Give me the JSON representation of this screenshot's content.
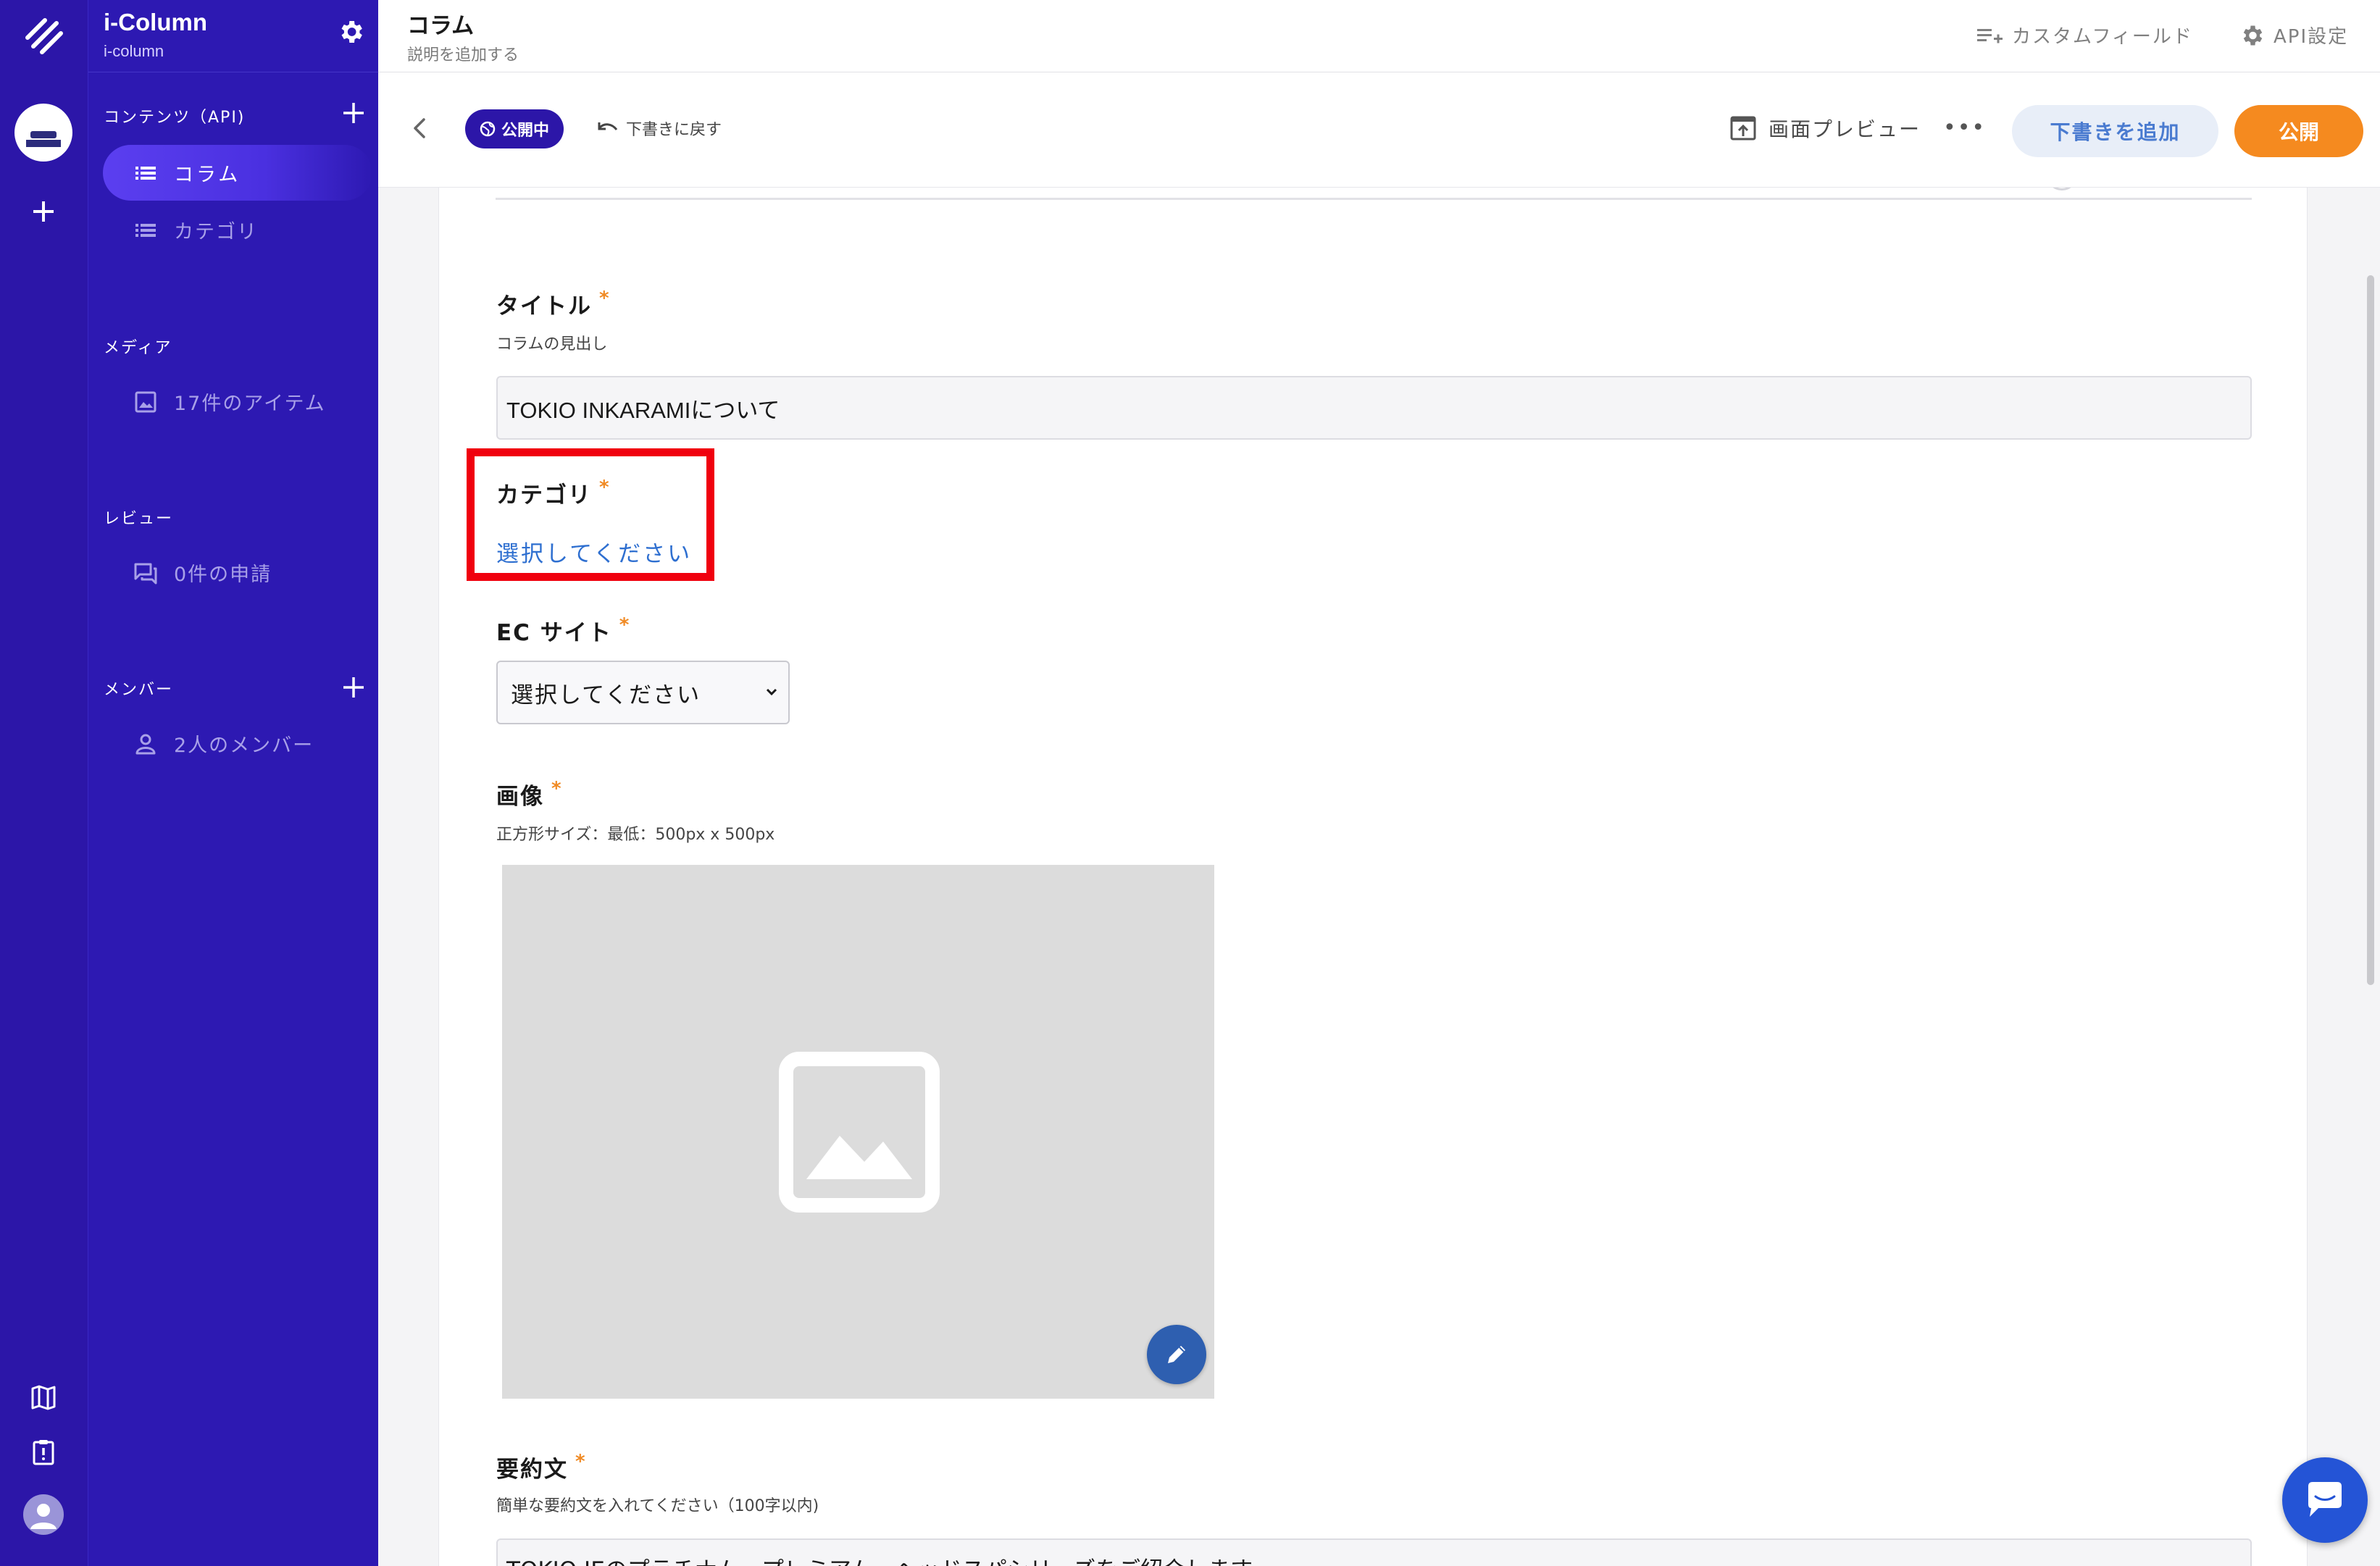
{
  "app": {
    "name": "i-Column",
    "id": "i-column"
  },
  "sidebar": {
    "contents_label": "コンテンツ（API)",
    "items": [
      {
        "label": "コラム",
        "active": true
      },
      {
        "label": "カテゴリ",
        "active": false
      }
    ],
    "media_label": "メディア",
    "media_item": "17件のアイテム",
    "review_label": "レビュー",
    "review_item": "0件の申請",
    "members_label": "メンバー",
    "members_item": "2人のメンバー"
  },
  "header": {
    "title": "コラム",
    "description": "説明を追加する",
    "custom_field": "カスタムフィールド",
    "api_settings": "API設定"
  },
  "toolbar": {
    "status": "公開中",
    "revert": "下書きに戻す",
    "preview": "画面プレビュー",
    "more": "•••",
    "add_draft": "下書きを追加",
    "publish": "公開"
  },
  "form": {
    "title_field": {
      "label": "タイトル",
      "required": "*",
      "help": "コラムの見出し",
      "value": "TOKIO INKARAMIについて"
    },
    "category_field": {
      "label": "カテゴリ",
      "required": "*",
      "value": "選択してください"
    },
    "ec_field": {
      "label": "EC サイト",
      "required": "*",
      "value": "選択してください"
    },
    "image_field": {
      "label": "画像",
      "required": "*",
      "help": "正方形サイズ：最低：500px x 500px"
    },
    "summary_field": {
      "label": "要約文",
      "required": "*",
      "help": "簡単な要約文を入れてください（100字以内)",
      "value": "TOKIO IEのプラチナム・プレミアム・ヘッドスパシリーズをご紹介します"
    }
  },
  "colors": {
    "sidebar": "#2d19b2",
    "rail": "#2c16a8",
    "accent_orange": "#f58a1f",
    "highlight_red": "#f0000e",
    "link_blue": "#2e6fd0"
  },
  "icons": [
    "logo-icon",
    "plus-icon",
    "map-icon",
    "clipboard-alert-icon",
    "user-avatar-icon",
    "gear-icon",
    "list-icon",
    "image-icon",
    "chat-icon",
    "person-icon",
    "custom-field-icon",
    "chevron-left-icon",
    "globe-icon",
    "undo-icon",
    "preview-icon",
    "pencil-icon",
    "chevron-down-icon"
  ]
}
